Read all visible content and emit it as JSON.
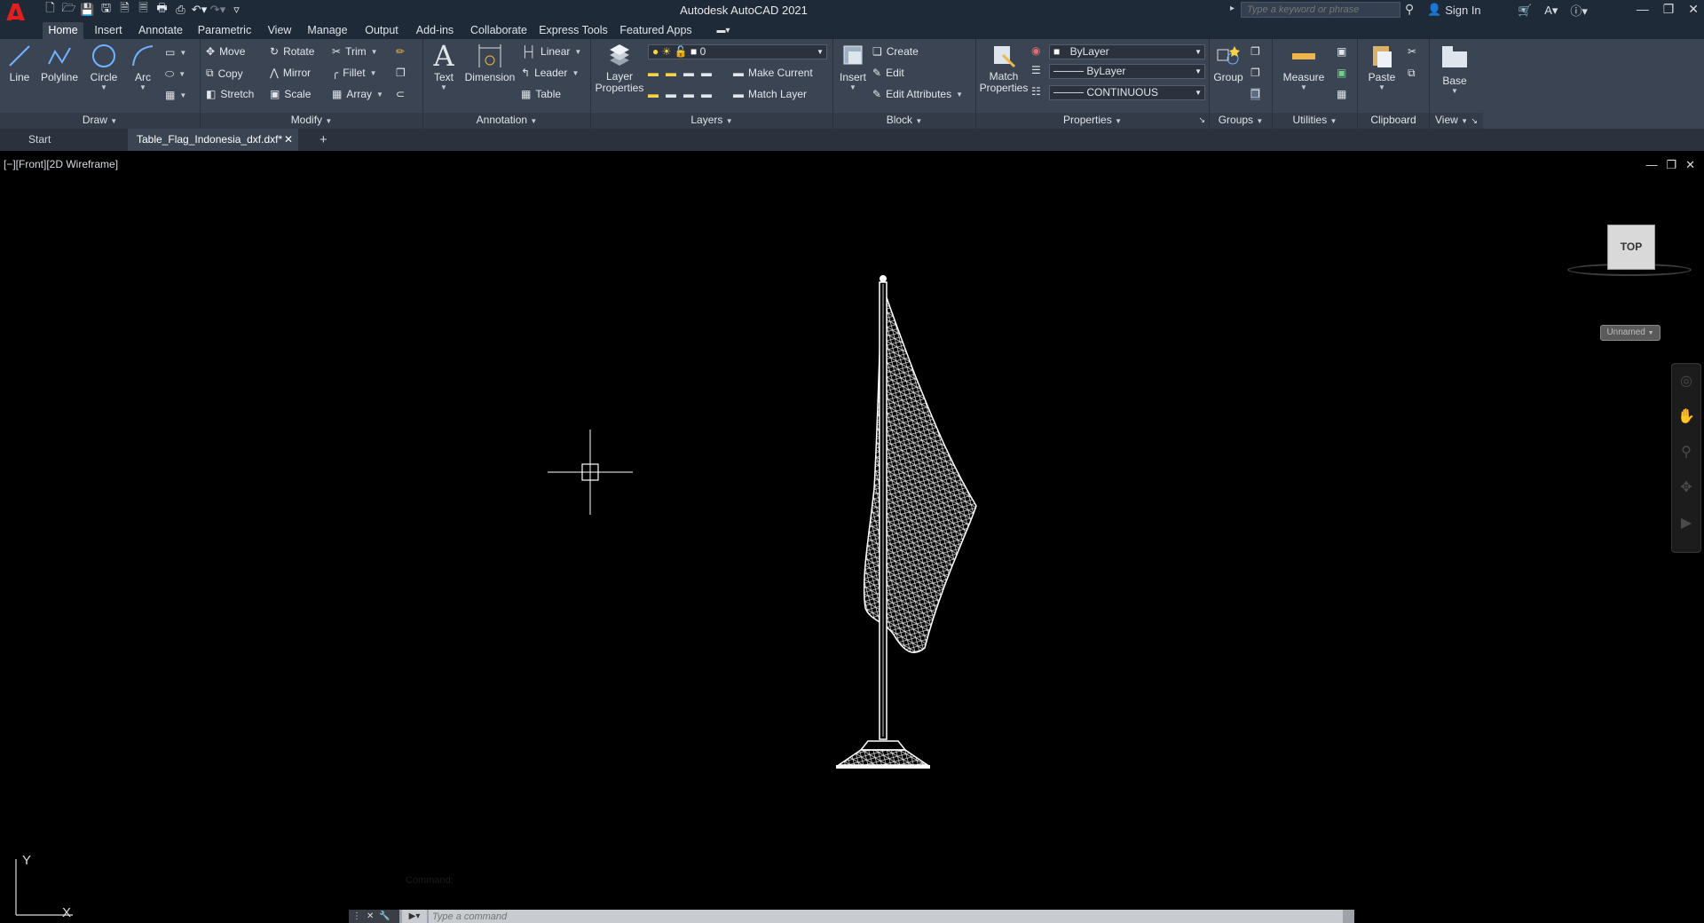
{
  "titlebar": {
    "app_title": "Autodesk AutoCAD 2021",
    "search_placeholder": "Type a keyword or phrase",
    "sign_in": "Sign In"
  },
  "ribbon_tabs": [
    "Home",
    "Insert",
    "Annotate",
    "Parametric",
    "View",
    "Manage",
    "Output",
    "Add-ins",
    "Collaborate",
    "Express Tools",
    "Featured Apps"
  ],
  "panels": {
    "draw": {
      "title": "Draw",
      "line": "Line",
      "polyline": "Polyline",
      "circle": "Circle",
      "arc": "Arc"
    },
    "modify": {
      "title": "Modify",
      "move": "Move",
      "rotate": "Rotate",
      "trim": "Trim",
      "copy": "Copy",
      "mirror": "Mirror",
      "fillet": "Fillet",
      "stretch": "Stretch",
      "scale": "Scale",
      "array": "Array"
    },
    "annotation": {
      "title": "Annotation",
      "text": "Text",
      "dimension": "Dimension",
      "linear": "Linear",
      "leader": "Leader",
      "table": "Table"
    },
    "layers": {
      "title": "Layers",
      "layer_properties_1": "Layer",
      "layer_properties_2": "Properties",
      "current_layer": "0",
      "make_current": "Make Current",
      "match_layer": "Match Layer"
    },
    "block": {
      "title": "Block",
      "insert": "Insert",
      "create": "Create",
      "edit": "Edit",
      "edit_attributes": "Edit Attributes"
    },
    "properties": {
      "title": "Properties",
      "match_1": "Match",
      "match_2": "Properties",
      "color": "ByLayer",
      "lineweight": "ByLayer",
      "linetype": "CONTINUOUS"
    },
    "groups": {
      "title": "Groups",
      "group": "Group"
    },
    "utilities": {
      "title": "Utilities",
      "measure": "Measure"
    },
    "clipboard": {
      "title": "Clipboard",
      "paste": "Paste"
    },
    "view": {
      "title": "View",
      "base": "Base"
    }
  },
  "doc_tabs": {
    "start": "Start",
    "active": "Table_Flag_Indonesia_dxf.dxf*"
  },
  "viewport": {
    "label": "[−][Front][2D Wireframe]",
    "viewcube_face": "TOP",
    "ucs_name": "Unnamed",
    "ucs_x": "X",
    "ucs_y": "Y"
  },
  "command": {
    "placeholder": "Type a command",
    "history": "Command:"
  },
  "colors": {
    "ribbon_bg": "#3b4453",
    "title_bg": "#1f2a38",
    "canvas_bg": "#000000",
    "logo_red": "#e02020"
  }
}
